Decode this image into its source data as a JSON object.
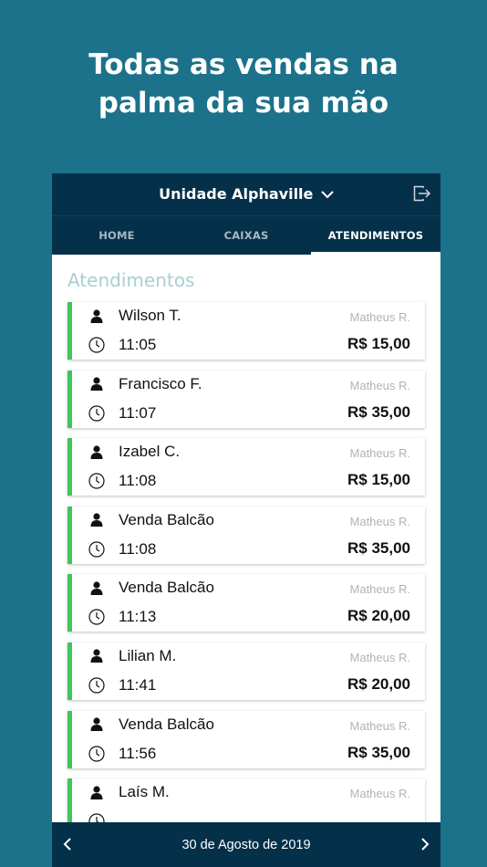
{
  "headline": {
    "line1": "Todas as vendas na",
    "line2": "palma da sua mão"
  },
  "header": {
    "unit": "Unidade Alphaville"
  },
  "tabs": [
    {
      "label": "HOME",
      "active": false
    },
    {
      "label": "CAIXAS",
      "active": false
    },
    {
      "label": "ATENDIMENTOS",
      "active": true
    }
  ],
  "section_title": "Atendimentos",
  "items": [
    {
      "name": "Wilson T.",
      "time": "11:05",
      "seller": "Matheus R.",
      "amount": "R$ 15,00"
    },
    {
      "name": "Francisco F.",
      "time": "11:07",
      "seller": "Matheus R.",
      "amount": "R$ 35,00"
    },
    {
      "name": "Izabel C.",
      "time": "11:08",
      "seller": "Matheus R.",
      "amount": "R$ 15,00"
    },
    {
      "name": "Venda Balcão",
      "time": "11:08",
      "seller": "Matheus R.",
      "amount": "R$ 35,00"
    },
    {
      "name": "Venda Balcão",
      "time": "11:13",
      "seller": "Matheus R.",
      "amount": "R$ 20,00"
    },
    {
      "name": "Lilian M.",
      "time": "11:41",
      "seller": "Matheus R.",
      "amount": "R$ 20,00"
    },
    {
      "name": "Venda Balcão",
      "time": "11:56",
      "seller": "Matheus R.",
      "amount": "R$ 35,00"
    },
    {
      "name": "Laís M.",
      "time": "",
      "seller": "Matheus R.",
      "amount": ""
    }
  ],
  "footer": {
    "date": "30 de Agosto de 2019"
  },
  "icons": {
    "dropdown": "chevron-down-icon",
    "logout": "logout-icon",
    "person": "person-icon",
    "clock": "clock-icon",
    "prev": "chevron-left-icon",
    "next": "chevron-right-icon"
  },
  "colors": {
    "background": "#1b728a",
    "header": "#05304a",
    "accent": "#3ec65a",
    "section_title": "#a8cfd4"
  }
}
